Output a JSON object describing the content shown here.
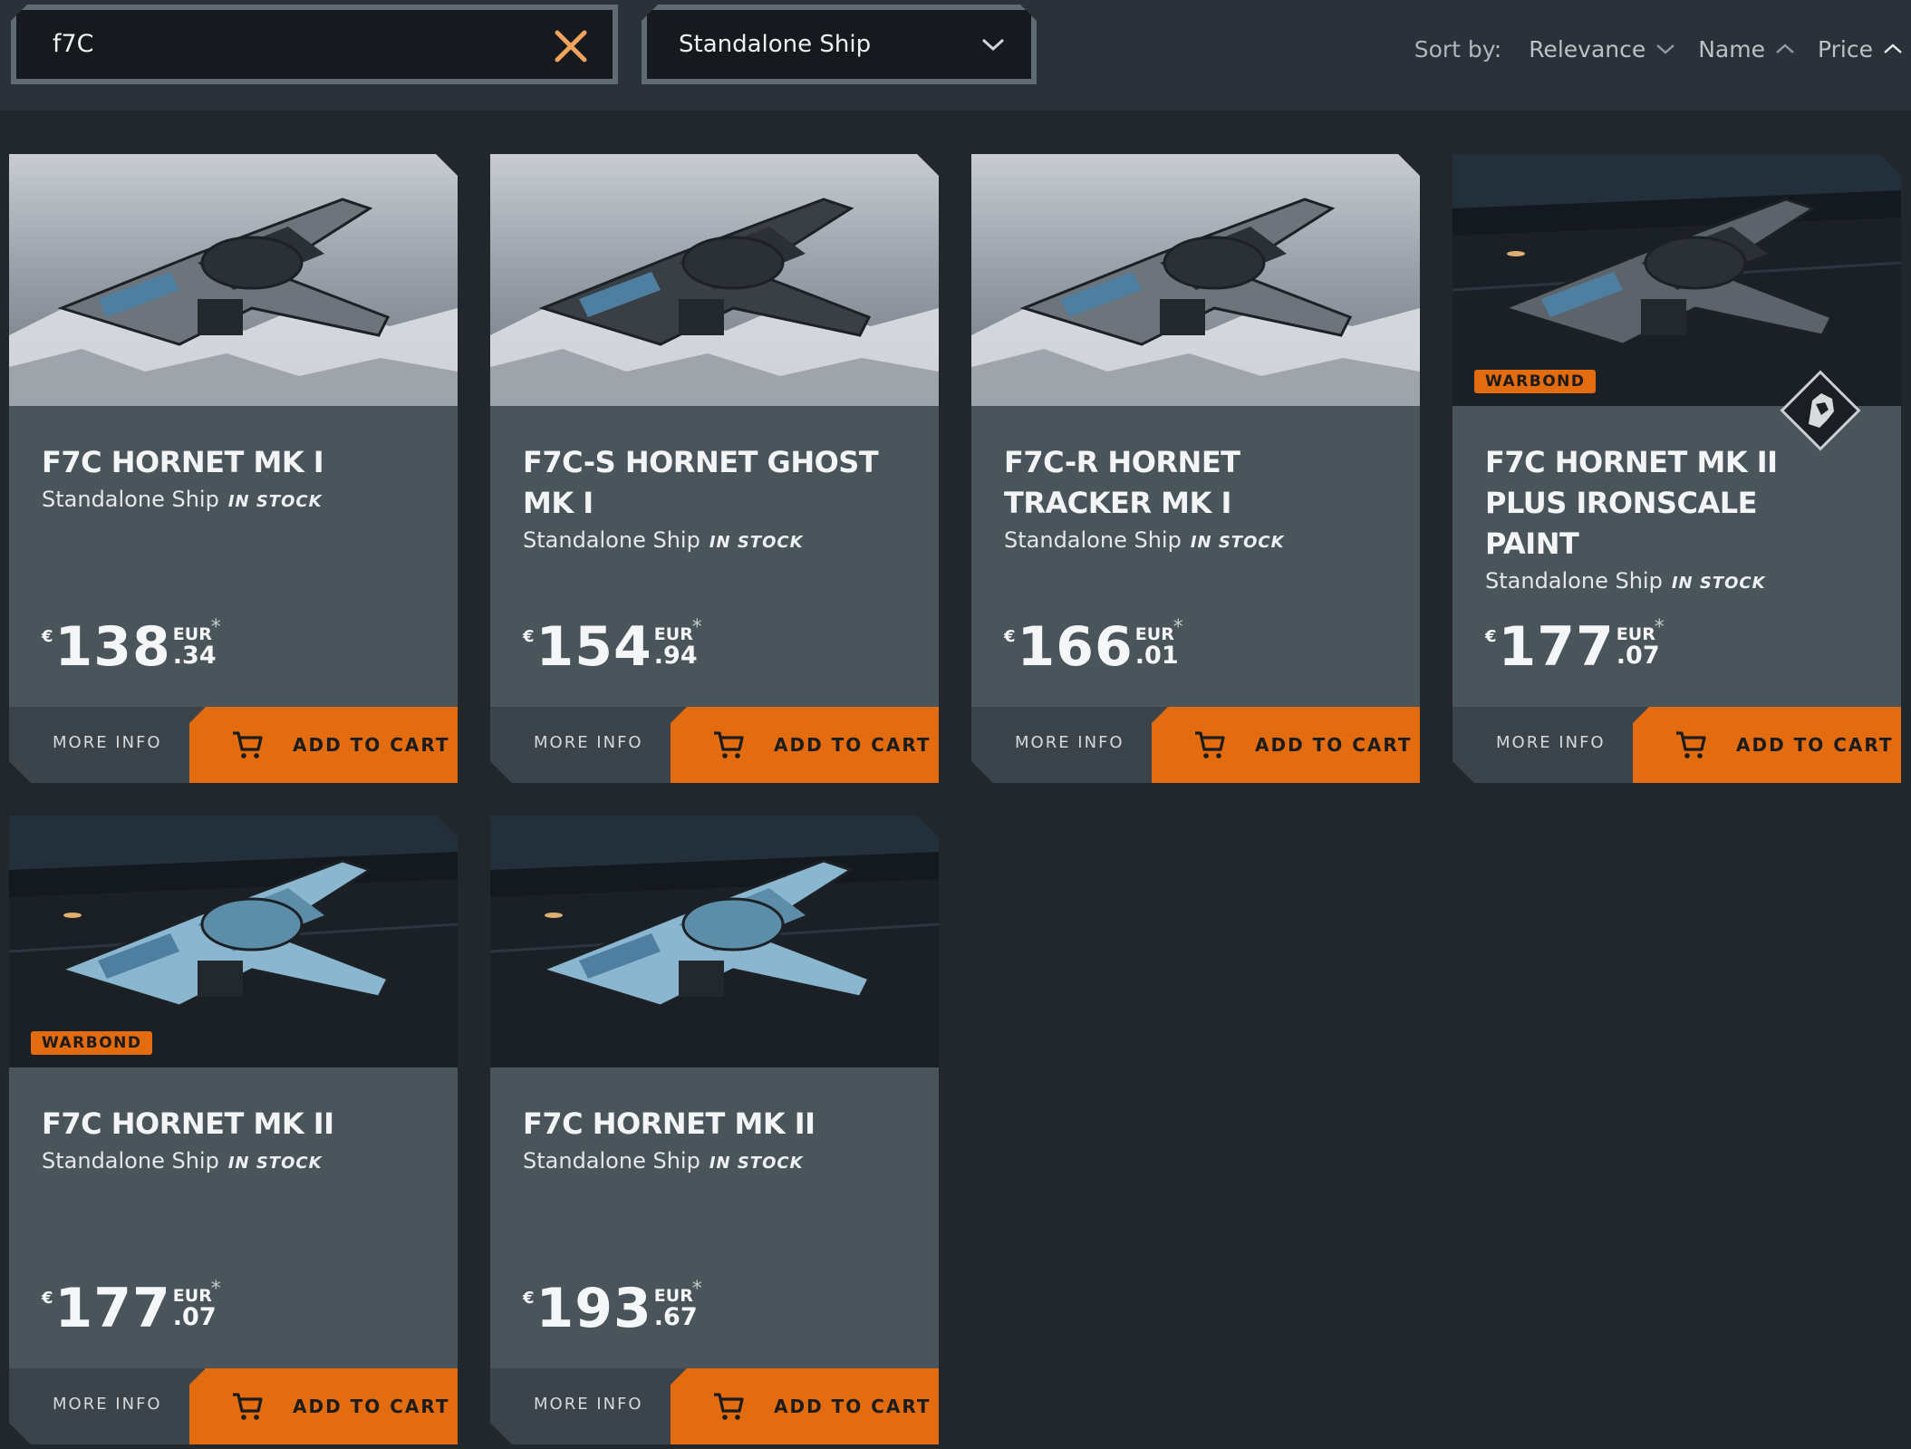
{
  "search": {
    "value": "f7C"
  },
  "type_filter": {
    "selected": "Standalone Ship"
  },
  "sort": {
    "label": "Sort by:",
    "options": [
      {
        "label": "Relevance",
        "direction": "down"
      },
      {
        "label": "Name",
        "direction": "up"
      },
      {
        "label": "Price",
        "direction": "up"
      }
    ]
  },
  "colors": {
    "accent": "#e36b10",
    "card_bg": "#4a545b",
    "page_bg": "#22272c"
  },
  "products": [
    {
      "name": "F7C HORNET MK I",
      "type": "Standalone Ship",
      "stock": "IN STOCK",
      "currency_symbol": "€",
      "price_int": "138",
      "price_dec": ".34",
      "currency": "EUR",
      "footnote": "*",
      "badge": "",
      "image": "sky-ship-grey",
      "more_label": "MORE INFO",
      "cart_label": "ADD TO CART"
    },
    {
      "name": "F7C-S HORNET GHOST MK I",
      "type": "Standalone Ship",
      "stock": "IN STOCK",
      "currency_symbol": "€",
      "price_int": "154",
      "price_dec": ".94",
      "currency": "EUR",
      "footnote": "*",
      "badge": "",
      "image": "sky-ship-dark",
      "more_label": "MORE INFO",
      "cart_label": "ADD TO CART"
    },
    {
      "name": "F7C-R HORNET TRACKER MK I",
      "type": "Standalone Ship",
      "stock": "IN STOCK",
      "currency_symbol": "€",
      "price_int": "166",
      "price_dec": ".01",
      "currency": "EUR",
      "footnote": "*",
      "badge": "",
      "image": "sky-ship-radar",
      "more_label": "MORE INFO",
      "cart_label": "ADD TO CART"
    },
    {
      "name": "F7C HORNET MK II PLUS IRONSCALE PAINT",
      "type": "Standalone Ship",
      "stock": "IN STOCK",
      "currency_symbol": "€",
      "price_int": "177",
      "price_dec": ".07",
      "currency": "EUR",
      "footnote": "*",
      "badge": "WARBOND",
      "emblem": "lion-emblem-icon",
      "image": "hangar-ship-dark",
      "more_label": "MORE INFO",
      "cart_label": "ADD TO CART"
    },
    {
      "name": "F7C HORNET MK II",
      "type": "Standalone Ship",
      "stock": "IN STOCK",
      "currency_symbol": "€",
      "price_int": "177",
      "price_dec": ".07",
      "currency": "EUR",
      "footnote": "*",
      "badge": "WARBOND",
      "image": "hangar-ship-blue",
      "more_label": "MORE INFO",
      "cart_label": "ADD TO CART"
    },
    {
      "name": "F7C HORNET MK II",
      "type": "Standalone Ship",
      "stock": "IN STOCK",
      "currency_symbol": "€",
      "price_int": "193",
      "price_dec": ".67",
      "currency": "EUR",
      "footnote": "*",
      "badge": "",
      "image": "hangar-ship-blue",
      "more_label": "MORE INFO",
      "cart_label": "ADD TO CART"
    }
  ]
}
